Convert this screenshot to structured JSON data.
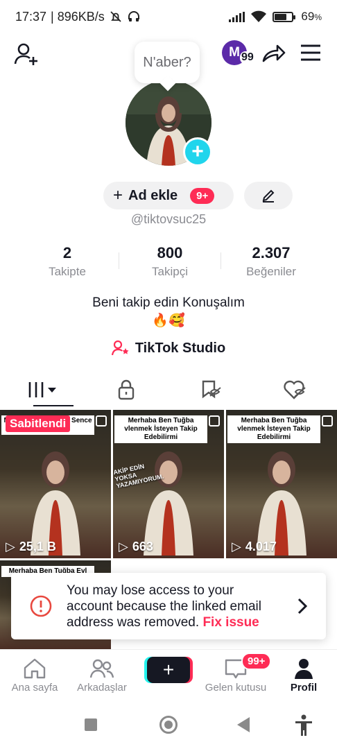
{
  "status_bar": {
    "time": "17:37",
    "speed": "| 896KB/s",
    "battery": "69",
    "battery_level": 0.69
  },
  "header": {
    "avatar_letter": "M",
    "avatar_badge": "99",
    "icons": [
      "add-user-icon",
      "share-icon",
      "menu-icon"
    ]
  },
  "profile": {
    "bubble_text": "N'aber?",
    "add_name_label": "Ad ekle",
    "add_name_badge": "9+",
    "username": "@tiktovsuc25",
    "bio_line1": "Beni takip edin Konuşalım",
    "bio_line2": "🔥🥰",
    "studio_label": "TikTok Studio"
  },
  "stats": [
    {
      "value": "2",
      "label": "Takipte"
    },
    {
      "value": "800",
      "label": "Takipçi"
    },
    {
      "value": "2.307",
      "label": "Beğeniler"
    }
  ],
  "tabs": [
    "videos-grid-icon",
    "lock-icon",
    "tagged-icon",
    "liked-icon"
  ],
  "videos": [
    {
      "caption": "Merhaba Ben Tuğba Sence Güzelmiyim",
      "views": "25,1 B",
      "pinned": "Sabitlendi"
    },
    {
      "caption": "Merhaba Ben Tuğba vlenmek İsteyen Takip Edebilirmi",
      "overlay": "AKİP EDİN YOKSA YAZAMIYORUM.",
      "views": "663"
    },
    {
      "caption": "Merhaba Ben Tuğba vlenmek İsteyen Takip Edebilirmi",
      "views": "4.017"
    },
    {
      "caption": "Merhaba Ben Tuğba Evl"
    }
  ],
  "toast": {
    "message": "You may lose access to your account because the linked email address was removed.",
    "action": "Fix issue"
  },
  "bottom_nav": {
    "home": "Ana sayfa",
    "friends": "Arkadaşlar",
    "inbox": "Gelen kutusu",
    "inbox_badge": "99+",
    "profile": "Profil"
  },
  "colors": {
    "accent_red": "#fe2c55",
    "accent_cyan": "#20d5ec"
  }
}
